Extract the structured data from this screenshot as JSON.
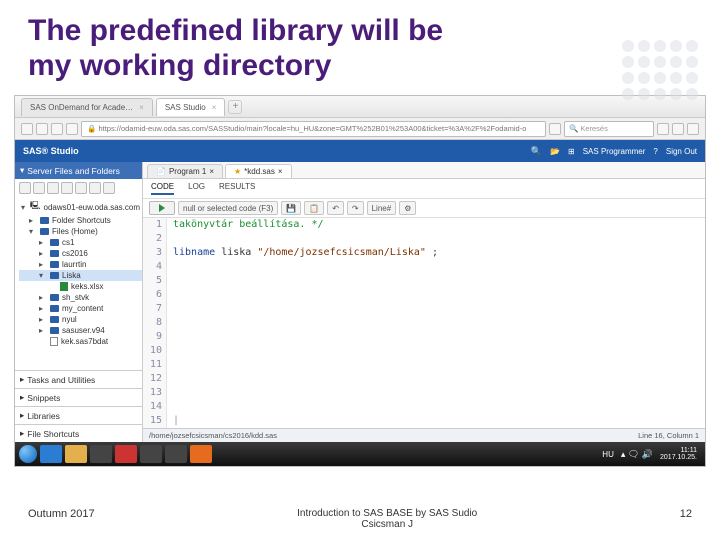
{
  "slide": {
    "title_l1": "The predefined library will be",
    "title_l2": "my working directory"
  },
  "browser": {
    "tabs": [
      {
        "label": "SAS OnDemand for Acade…"
      },
      {
        "label": "SAS Studio"
      }
    ],
    "url": "https://odamid-euw.oda.sas.com/SASStudio/main?locale=hu_HU&zone=GMT%252B01%253A00&ticket=%3A%2F%2Fodamid-o",
    "search_placeholder": "Keresés"
  },
  "app": {
    "brand": "SAS® Studio",
    "role": "SAS Programmer",
    "signout": "Sign Out"
  },
  "sidebar": {
    "header": "Server Files and Folders",
    "root": "odaws01-euw.oda.sas.com",
    "folders": {
      "shortcuts": "Folder Shortcuts",
      "home": "Files (Home)",
      "items": [
        "cs1",
        "cs2016",
        "laurrtin",
        "Liska",
        "keks.xlsx",
        "sh_stvk",
        "my_content",
        "nyul",
        "sasuser.v94",
        "kek.sas7bdat"
      ]
    },
    "sections": {
      "tasks": "Tasks and Utilities",
      "snippets": "Snippets",
      "libraries": "Libraries",
      "shortcuts": "File Shortcuts"
    }
  },
  "editor": {
    "tabs": [
      {
        "label": "Program 1"
      },
      {
        "label": "*kdd.sas"
      }
    ],
    "subtabs": {
      "code": "CODE",
      "log": "LOG",
      "results": "RESULTS"
    },
    "run_hint": "null or selected code (F3)",
    "line_lbl": "Line#",
    "lines": {
      "1": "takönyvtár beállítása. */",
      "3a": "libname",
      "3b": "liska",
      "3c": "\"/home/jozsefcsicsman/Liska\"",
      "3d": ";"
    },
    "gutter": [
      "1",
      "2",
      "3",
      "4",
      "5",
      "6",
      "7",
      "8",
      "9",
      "10",
      "11",
      "12",
      "13",
      "14",
      "15"
    ],
    "status_left": "/home/jozsefcsicsman/cs2016/kdd.sas",
    "status_right": "Line 16, Column 1"
  },
  "taskbar": {
    "lang": "HU",
    "time": "11:11",
    "date": "2017.10.25."
  },
  "footer": {
    "left": "Outumn 2017",
    "center_l1": "Introduction to SAS BASE by SAS Sudio",
    "center_l2": "Csicsman J",
    "right": "12"
  }
}
